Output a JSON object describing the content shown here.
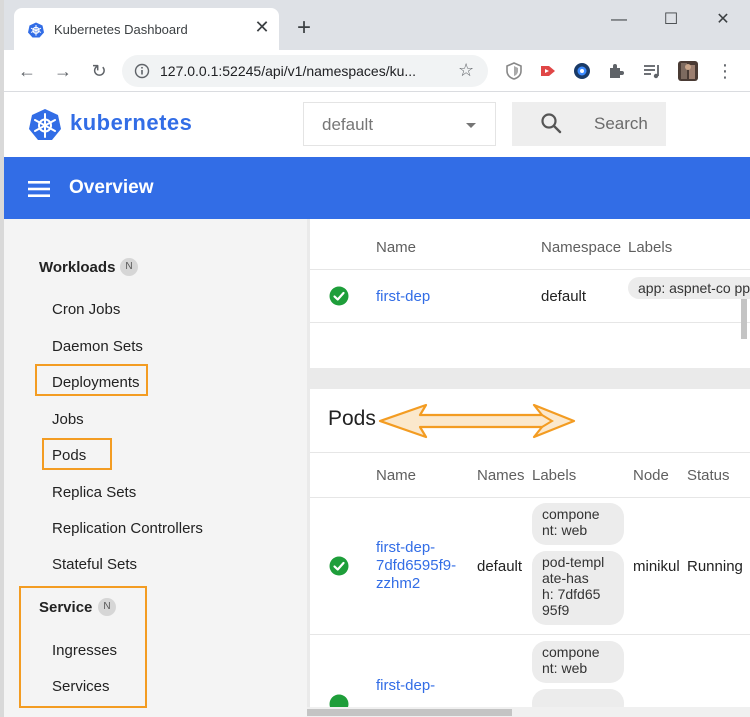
{
  "browser": {
    "tab_title": "Kubernetes Dashboard",
    "url": "127.0.0.1:52245/api/v1/namespaces/ku..."
  },
  "header": {
    "brand": "kubernetes",
    "namespace": "default",
    "search_label": "Search"
  },
  "topbar": {
    "title": "Overview"
  },
  "sidebar": {
    "workloads": {
      "title": "Workloads",
      "badge": "N"
    },
    "items": [
      "Cron Jobs",
      "Daemon Sets",
      "Deployments",
      "Jobs",
      "Pods",
      "Replica Sets",
      "Replication Controllers",
      "Stateful Sets"
    ],
    "service": {
      "title": "Service",
      "badge": "N"
    },
    "service_items": [
      "Ingresses",
      "Services"
    ]
  },
  "deployments": {
    "headers": {
      "name": "Name",
      "namespace": "Namespace",
      "labels": "Labels"
    },
    "row": {
      "name": "first-dep",
      "namespace": "default",
      "label": "app: aspnet-co pp"
    }
  },
  "pods": {
    "title": "Pods",
    "headers": {
      "name": "Name",
      "namespace": "Names",
      "labels": "Labels",
      "node": "Node",
      "status": "Status"
    },
    "row1": {
      "name_l1": "first-dep-",
      "name_l2": "7dfd6595f9-",
      "name_l3": "zzhm2",
      "namespace": "default",
      "label1_l1": "compone",
      "label1_l2": "nt: web",
      "label2_l1": "pod-templ",
      "label2_l2": "ate-has",
      "label2_l3": "h: 7dfd65",
      "label2_l4": "95f9",
      "node": "minikul",
      "status": "Running"
    },
    "row2": {
      "name_l1": "first-dep-",
      "label1_l1": "compone",
      "label1_l2": "nt: web"
    }
  },
  "colors": {
    "brand": "#326de6",
    "highlight": "#f39c22",
    "success": "#1e9e3a"
  }
}
